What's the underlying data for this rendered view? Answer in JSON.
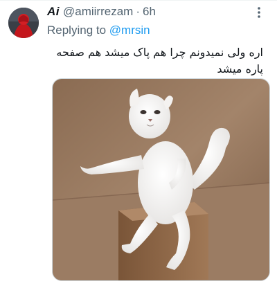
{
  "tweet": {
    "author": {
      "display_name": "Ai",
      "handle": "@amiirrezam",
      "separator": "·",
      "time": "6h"
    },
    "reply": {
      "prefix": "Replying to ",
      "mention": "@mrsin"
    },
    "text": "اره ولی نمیدونم چرا هم پاک میشد هم صفحه پاره میشد",
    "media": {
      "kind": "photo",
      "subject": "white-persian-cat-standing-meme"
    }
  },
  "icons": {
    "more": "more-vertical-icon"
  },
  "colors": {
    "accent": "#1d9bf0",
    "text_primary": "#0f1419",
    "text_secondary": "#536471",
    "border": "#cfd9de",
    "avatar_red": "#c4161c"
  }
}
